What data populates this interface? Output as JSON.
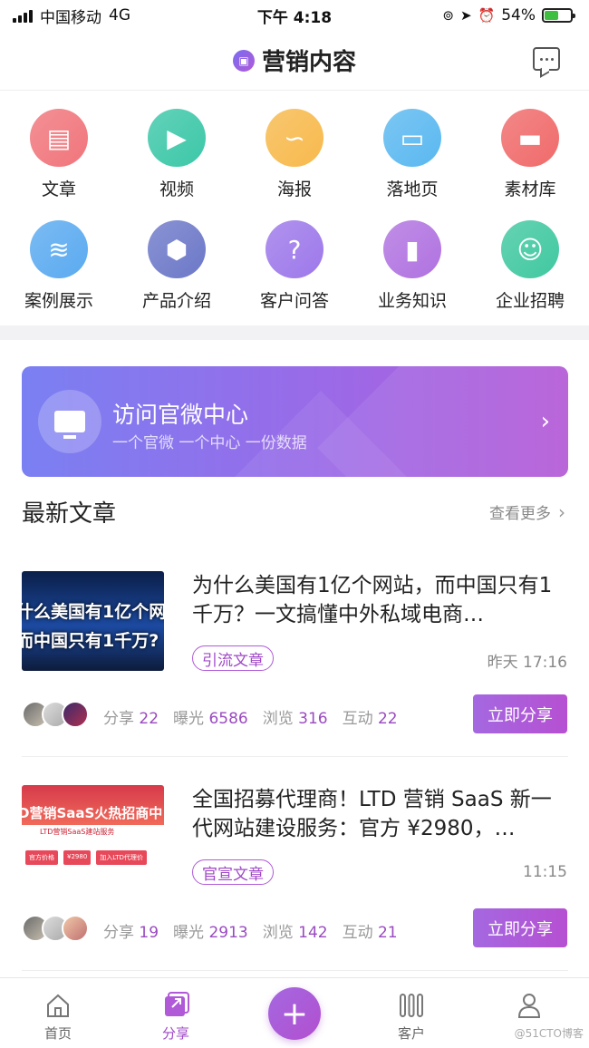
{
  "status_bar": {
    "carrier": "中国移动",
    "network": "4G",
    "time": "下午 4:18",
    "battery_level": 0.54,
    "battery_text": "54%"
  },
  "nav": {
    "title": "营销内容",
    "logo_icon": "brand-logo-icon",
    "message_icon": "message-bubble-icon"
  },
  "grid": [
    {
      "label": "文章",
      "icon": "document-icon",
      "color": "#f0757b"
    },
    {
      "label": "视频",
      "icon": "play-icon",
      "color": "#3cc7a8"
    },
    {
      "label": "海报",
      "icon": "poster-icon",
      "color": "#f7b94c"
    },
    {
      "label": "落地页",
      "icon": "browser-window-icon",
      "color": "#5ab8f0"
    },
    {
      "label": "素材库",
      "icon": "folder-icon",
      "color": "#f06a6a"
    },
    {
      "label": "案例展示",
      "icon": "layers-icon",
      "color": "#5aaaf0"
    },
    {
      "label": "产品介绍",
      "icon": "cube-icon",
      "color": "#6c78c8"
    },
    {
      "label": "客户问答",
      "icon": "question-icon",
      "color": "#9d78ea"
    },
    {
      "label": "业务知识",
      "icon": "book-icon",
      "color": "#b072e0"
    },
    {
      "label": "企业招聘",
      "icon": "person-card-icon",
      "color": "#40c8a0"
    }
  ],
  "banner": {
    "title": "访问官微中心",
    "subtitle": "一个官微 一个中心 一份数据"
  },
  "section": {
    "title": "最新文章",
    "see_more": "查看更多"
  },
  "articles": [
    {
      "thumb_lines": [
        "什么美国有1亿个网",
        "而中国只有1千万?"
      ],
      "title": "为什么美国有1亿个网站，而中国只有1千万？一文搞懂中外私域电商…",
      "tag": "引流文章",
      "time": "昨天 17:16",
      "share_label": "分享",
      "share": "22",
      "exposure_label": "曝光",
      "exposure": "6586",
      "views_label": "浏览",
      "views": "316",
      "interact_label": "互动",
      "interact": "22",
      "button": "立即分享"
    },
    {
      "thumb_lines": [
        "D营销SaaS火热招商中"
      ],
      "thumb_sub": "LTD营销SaaS建站服务",
      "title": "全国招募代理商！LTD 营销 SaaS 新一代网站建设服务：官方 ¥2980，…",
      "tag": "官宣文章",
      "time": "11:15",
      "share_label": "分享",
      "share": "19",
      "exposure_label": "曝光",
      "exposure": "2913",
      "views_label": "浏览",
      "views": "142",
      "interact_label": "互动",
      "interact": "21",
      "button": "立即分享"
    }
  ],
  "tabs": [
    {
      "label": "首页",
      "icon": "home-icon",
      "active": false
    },
    {
      "label": "分享",
      "icon": "share-icon",
      "active": true
    },
    {
      "label": "",
      "icon": "plus-icon",
      "active": false
    },
    {
      "label": "客户",
      "icon": "customer-icon",
      "active": false
    },
    {
      "label": "",
      "icon": "profile-icon",
      "active": false
    }
  ],
  "watermark": "@51CTO博客",
  "accent_color": "#a048c8"
}
